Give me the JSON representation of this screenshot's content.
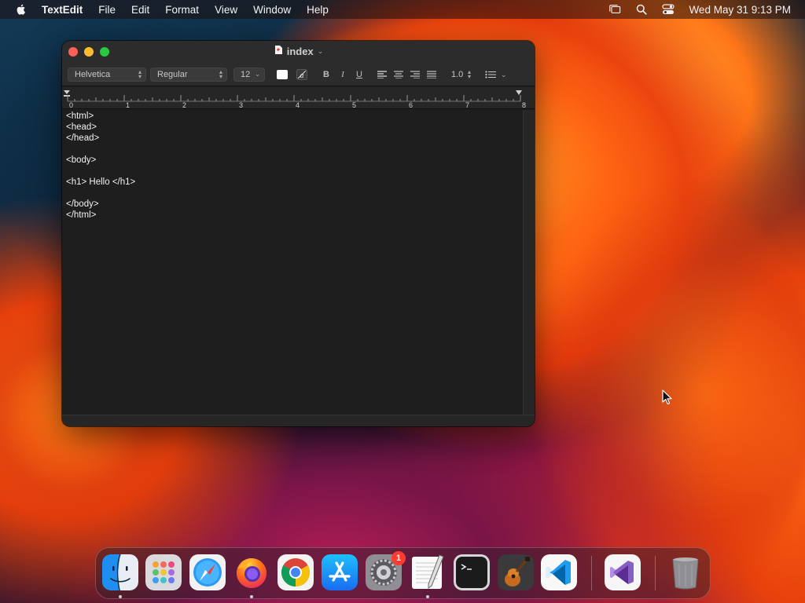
{
  "menubar": {
    "app_name": "TextEdit",
    "menus": [
      "File",
      "Edit",
      "Format",
      "View",
      "Window",
      "Help"
    ],
    "clock": "Wed May 31  9:13 PM"
  },
  "window": {
    "title": "index",
    "toolbar": {
      "font_family": "Helvetica",
      "font_style": "Regular",
      "font_size": "12",
      "bold_label": "B",
      "italic_label": "I",
      "underline_label": "U",
      "line_spacing": "1.0"
    },
    "ruler": {
      "labels": [
        "0",
        "1",
        "2",
        "3",
        "4",
        "5",
        "6",
        "7",
        "8"
      ]
    },
    "document": {
      "lines": [
        "<html>",
        "<head>",
        "</head>",
        "",
        "<body>",
        "",
        "<h1> Hello </h1>",
        "",
        "</body>",
        "</html>"
      ]
    }
  },
  "dock": {
    "apps": [
      {
        "name": "Finder",
        "icon": "finder-icon",
        "running": true
      },
      {
        "name": "Launchpad",
        "icon": "launchpad-icon",
        "running": false
      },
      {
        "name": "Safari",
        "icon": "safari-icon",
        "running": false
      },
      {
        "name": "Firefox",
        "icon": "firefox-icon",
        "running": true
      },
      {
        "name": "Google Chrome",
        "icon": "chrome-icon",
        "running": false
      },
      {
        "name": "App Store",
        "icon": "app-store-icon",
        "running": false
      },
      {
        "name": "System Settings",
        "icon": "system-settings-icon",
        "running": false,
        "badge": "1"
      },
      {
        "name": "TextEdit",
        "icon": "textedit-icon",
        "running": true
      },
      {
        "name": "Terminal",
        "icon": "terminal-icon",
        "running": false
      },
      {
        "name": "GarageBand",
        "icon": "garageband-icon",
        "running": false
      },
      {
        "name": "Visual Studio Code",
        "icon": "vscode-icon",
        "running": false
      },
      {
        "name": "Visual Studio",
        "icon": "visual-studio-icon",
        "running": false
      },
      {
        "name": "Trash",
        "icon": "trash-icon",
        "running": false
      }
    ]
  },
  "colors": {
    "close": "#fe5f57",
    "minimize": "#febc2e",
    "maximize": "#28c840",
    "badge": "#ff3b30"
  }
}
